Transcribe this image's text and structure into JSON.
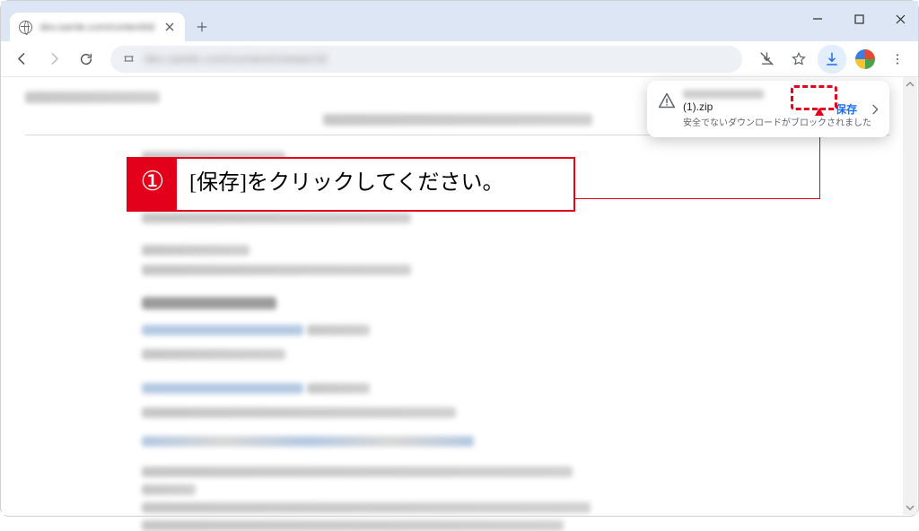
{
  "tab": {
    "title_blur": "dev.samle.com/content/id"
  },
  "address": {
    "url_blur": "dev.samle.com/content/viewer/id"
  },
  "download_popup": {
    "filename": "(1).zip",
    "message": "安全でないダウンロードがブロックされました",
    "save_label": "保存"
  },
  "callout": {
    "number": "①",
    "text": "[保存]をクリックしてください。"
  }
}
